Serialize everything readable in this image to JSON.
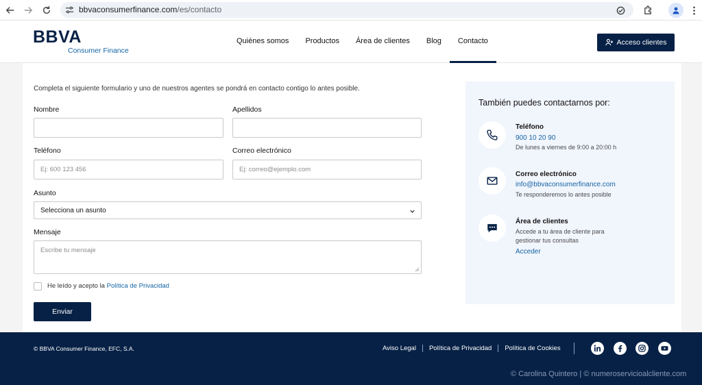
{
  "browser": {
    "url_domain": "bbvaconsumerfinance.com",
    "url_path": "/es/contacto"
  },
  "header": {
    "logo_text": "BBVA",
    "logo_subtitle": "Consumer Finance",
    "nav": [
      {
        "label": "Quiénes somos"
      },
      {
        "label": "Productos"
      },
      {
        "label": "Área de clientes"
      },
      {
        "label": "Blog"
      },
      {
        "label": "Contacto"
      }
    ],
    "active_nav": "Contacto",
    "access_button": "Acceso clientes"
  },
  "form": {
    "intro": "Completa el siguiente formulario y uno de nuestros agentes se pondrá en contacto contigo lo antes posible.",
    "nombre_label": "Nombre",
    "nombre_value": "",
    "apellidos_label": "Apellidos",
    "apellidos_value": "",
    "telefono_label": "Teléfono",
    "telefono_placeholder": "Ej: 600 123 456",
    "email_label": "Correo electrónico",
    "email_placeholder": "Ej: correo@ejemplo.com",
    "asunto_label": "Asunto",
    "asunto_selected": "Selecciona un asunto",
    "mensaje_label": "Mensaje",
    "mensaje_placeholder": "Escribe tu mensaje",
    "privacy_text": "He leído y acepto la ",
    "privacy_link": "Política de Privacidad",
    "privacy_checked": false,
    "send_button": "Enviar"
  },
  "side": {
    "title": "También puedes contactarnos por:",
    "phone_title": "Teléfono",
    "phone_value": "900 10 20 90",
    "phone_note": "De lunes a viernes de 9:00 a 20:00 h",
    "email_title": "Correo electrónico",
    "email_value": "info@bbvaconsumerfinance.com",
    "email_note": "Te responderemos lo antes posible",
    "area_title": "Área de clientes",
    "area_note": "Accede a tu área de cliente para gestionar tus consultas",
    "area_link": "Acceder"
  },
  "footer": {
    "copyright": "© BBVA Consumer Finance, EFC, S.A.",
    "links": [
      {
        "label": "Aviso Legal"
      },
      {
        "label": "Política de Privacidad"
      },
      {
        "label": "Política de Cookies"
      }
    ],
    "social": [
      "linkedin-icon",
      "facebook-icon",
      "instagram-icon",
      "youtube-icon"
    ],
    "watermark": "© Carolina Quintero | © numeroservicioalcliente.com"
  },
  "colors": {
    "navy": "#072146",
    "link_blue": "#1464a5",
    "panel_bg": "#f1f5fc"
  }
}
